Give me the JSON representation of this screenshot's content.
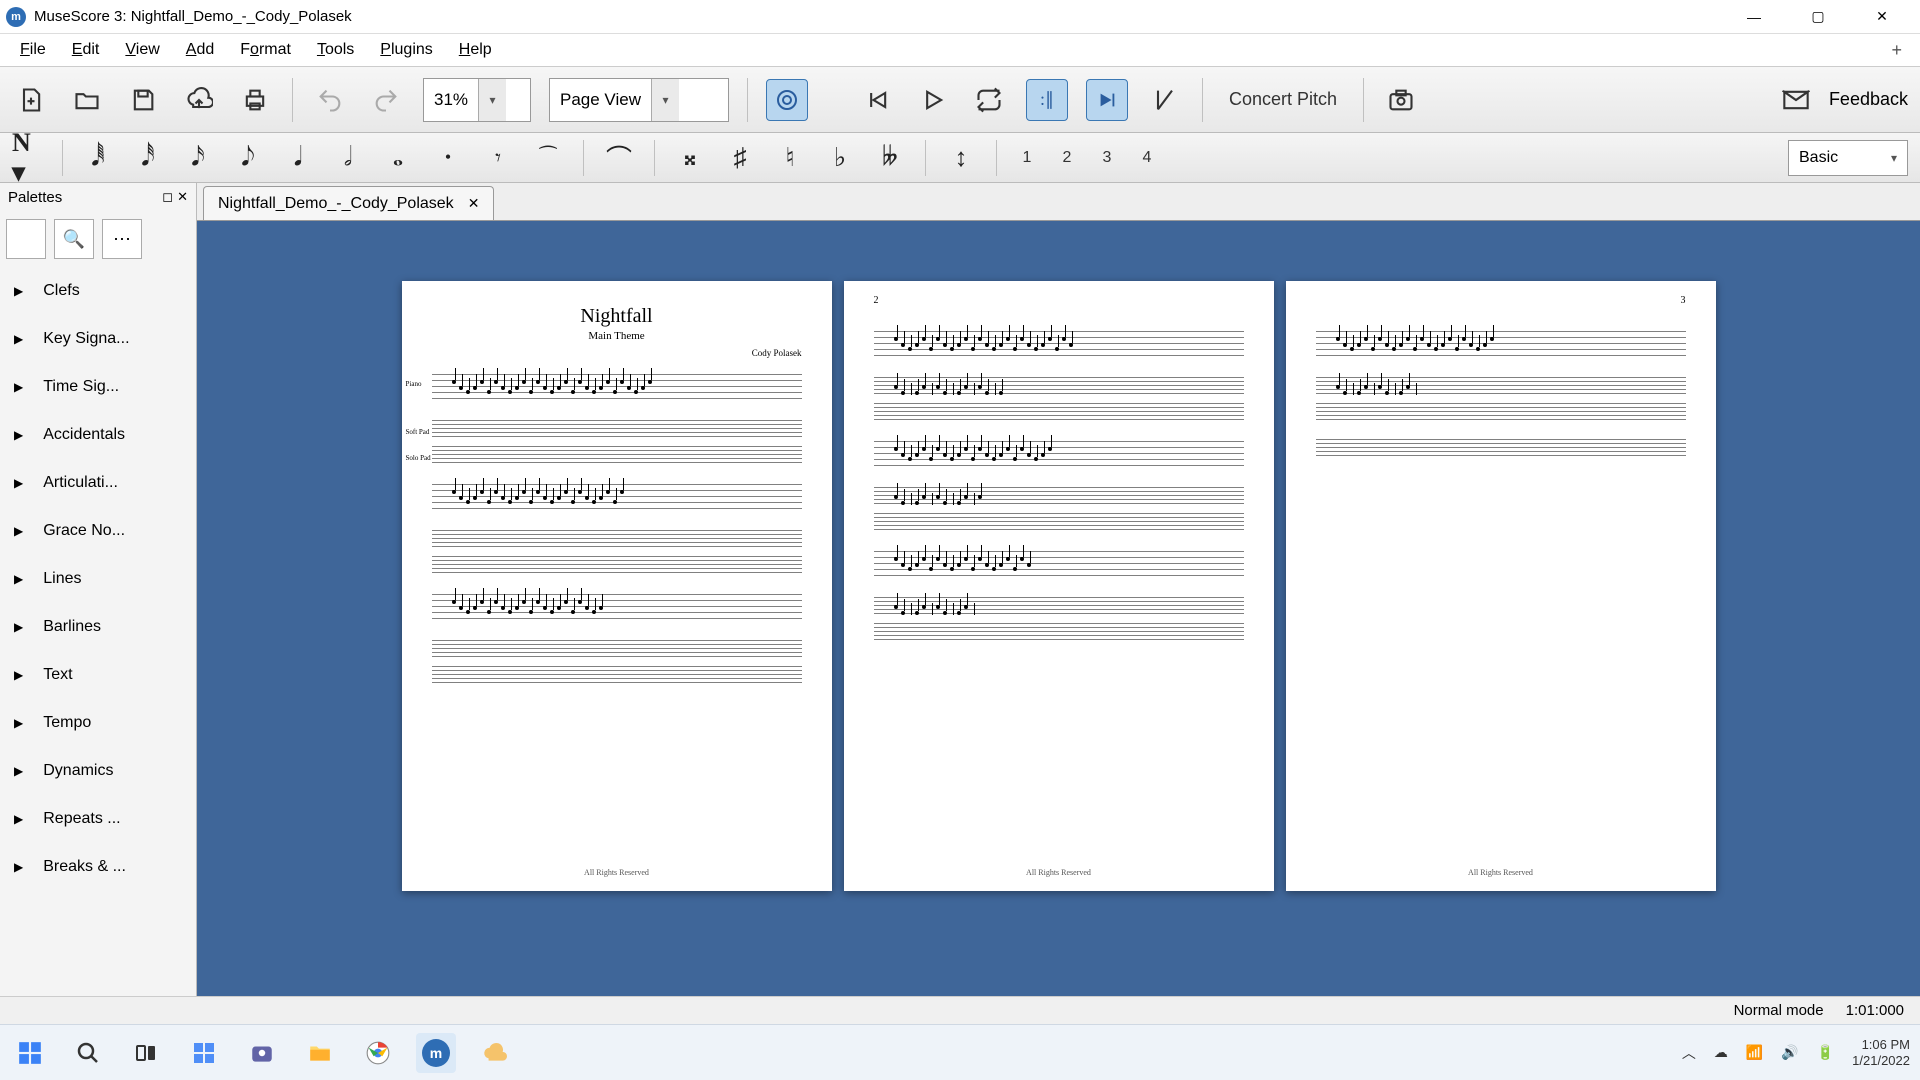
{
  "title": "MuseScore 3: Nightfall_Demo_-_Cody_Polasek",
  "menus": [
    "File",
    "Edit",
    "View",
    "Add",
    "Format",
    "Tools",
    "Plugins",
    "Help"
  ],
  "toolbar": {
    "zoom": "31%",
    "view_mode": "Page View",
    "concert_pitch": "Concert Pitch",
    "feedback": "Feedback"
  },
  "notebar": {
    "voices": [
      "1",
      "2",
      "3",
      "4"
    ],
    "workspace": "Basic"
  },
  "palettes": {
    "title": "Palettes",
    "items": [
      "Clefs",
      "Key Signa...",
      "Time Sig...",
      "Accidentals",
      "Articulati...",
      "Grace No...",
      "Lines",
      "Barlines",
      "Text",
      "Tempo",
      "Dynamics",
      "Repeats ...",
      "Breaks & ..."
    ]
  },
  "document_tab": "Nightfall_Demo_-_Cody_Polasek",
  "score": {
    "title": "Nightfall",
    "subtitle": "Main Theme",
    "composer": "Cody Polasek",
    "footer": "All Rights Reserved",
    "page_numbers": [
      "",
      "2",
      "3"
    ],
    "instruments": [
      "Piano",
      "Soft Pad",
      "Solo Pad"
    ]
  },
  "status": {
    "mode": "Normal mode",
    "time": "1:01:000"
  },
  "system": {
    "clock": "1:06 PM",
    "date": "1/21/2022"
  }
}
